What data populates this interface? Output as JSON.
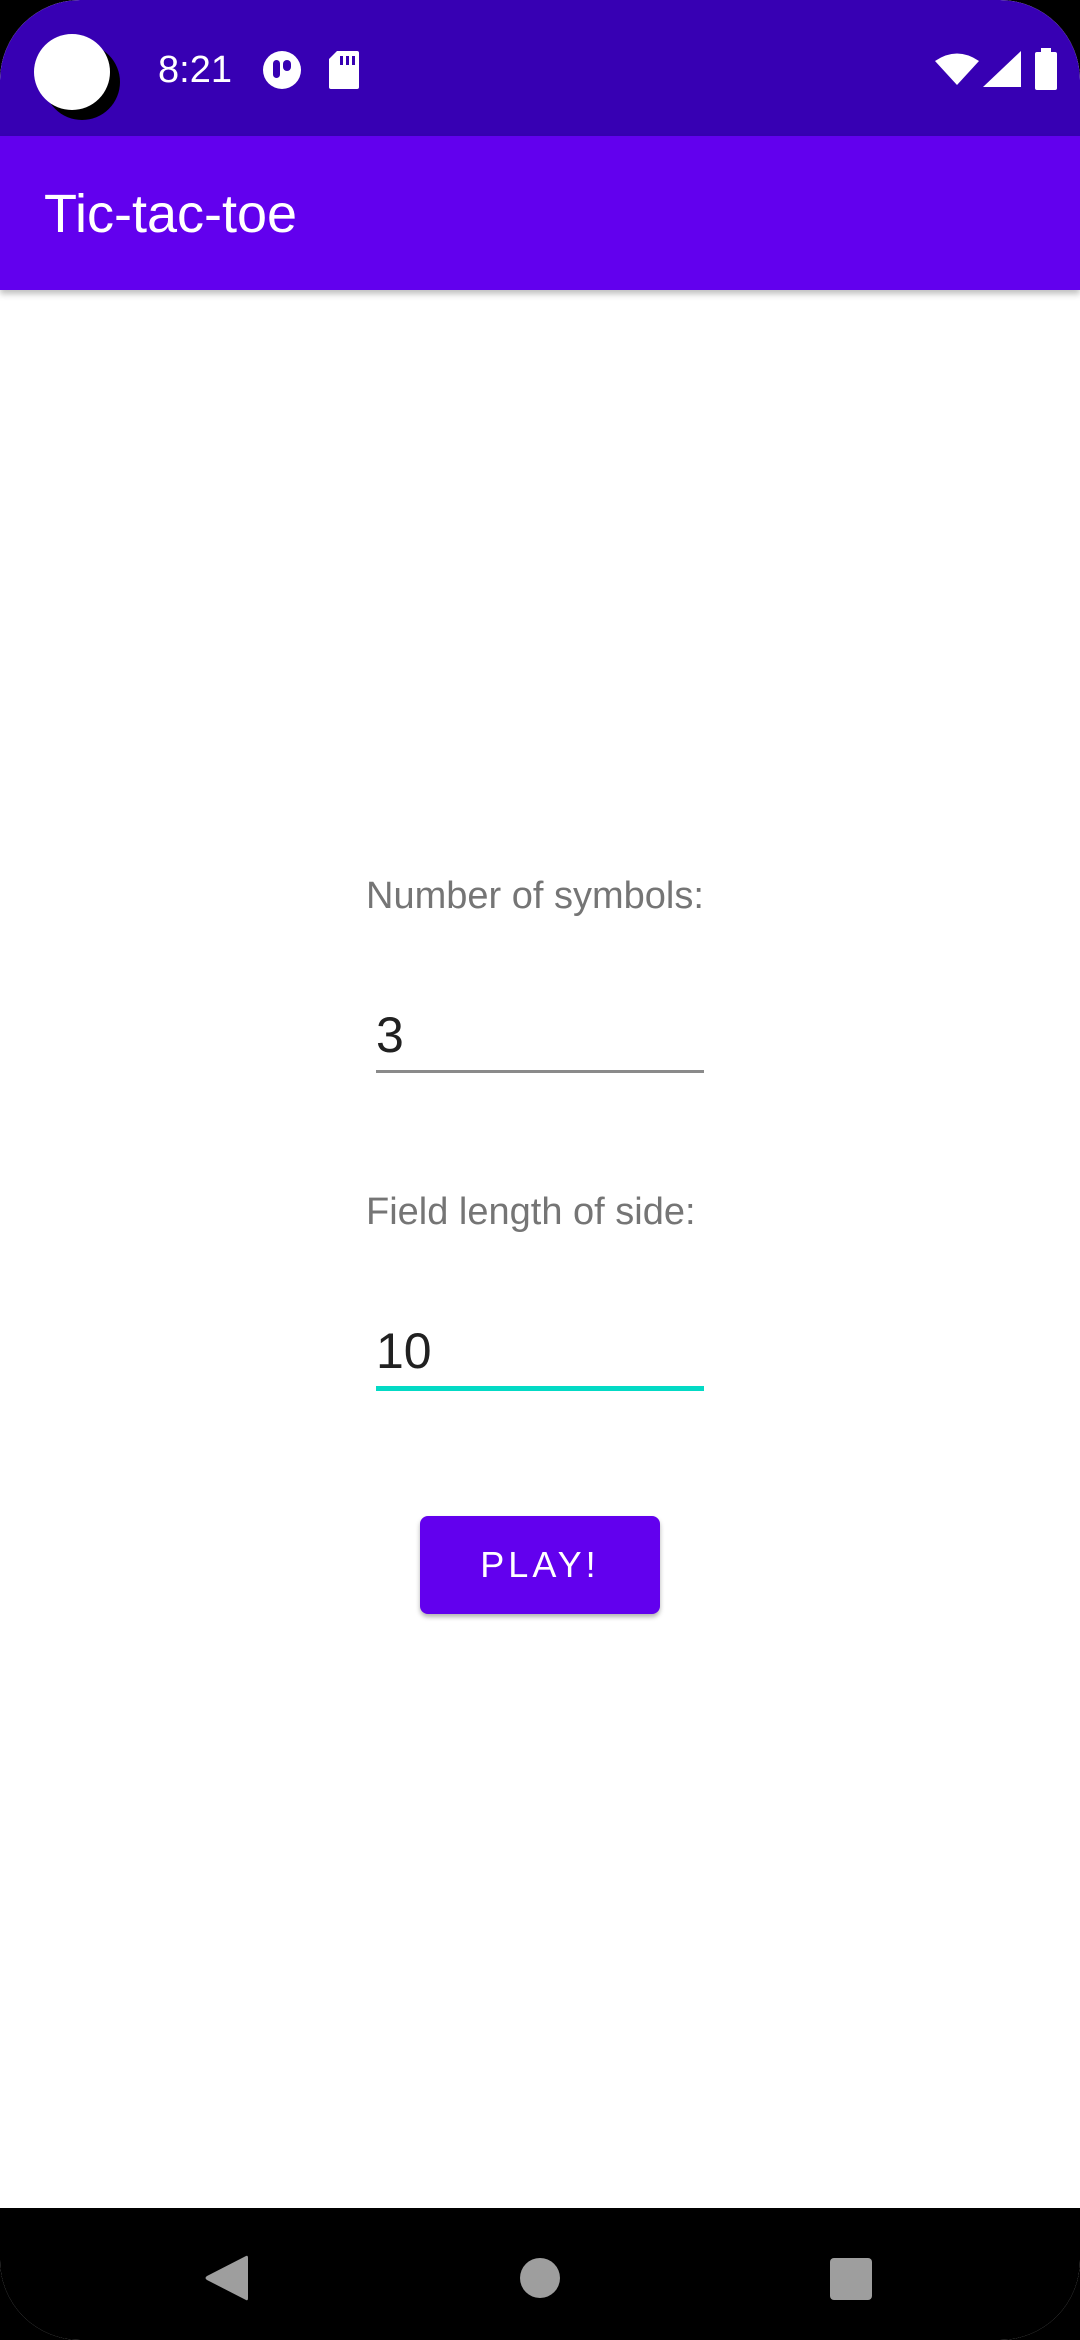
{
  "status_bar": {
    "time": "8:21",
    "icons": [
      "notification-app-icon",
      "sd-card-icon",
      "wifi-icon",
      "cell-signal-icon",
      "battery-icon"
    ]
  },
  "app_bar": {
    "title": "Tic-tac-toe"
  },
  "form": {
    "symbols_label": "Number of symbols:",
    "symbols_value": "3",
    "side_label": "Field length of side:",
    "side_value": "10",
    "play_label": "PLAY!"
  },
  "nav_bar": {
    "icons": [
      "back-icon",
      "home-icon",
      "recents-icon"
    ]
  },
  "colors": {
    "status_bar": "#3700b3",
    "primary": "#6200ee",
    "accent": "#03dac5",
    "label_text": "#757575"
  }
}
